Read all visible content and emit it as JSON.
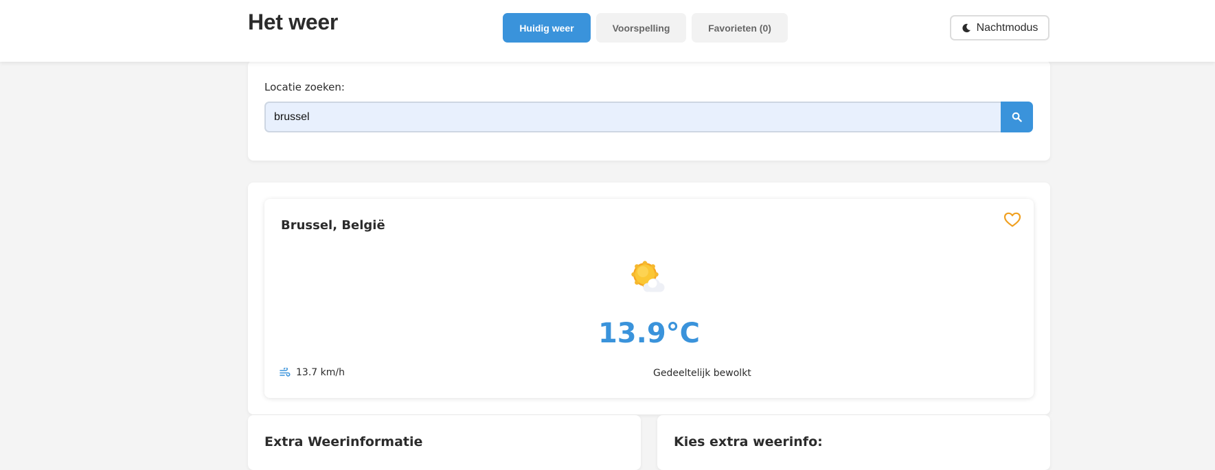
{
  "header": {
    "title": "Het weer",
    "tabs": [
      {
        "label": "Huidig weer",
        "active": true
      },
      {
        "label": "Voorspelling",
        "active": false
      },
      {
        "label": "Favorieten (0)",
        "active": false
      }
    ],
    "night_mode_label": "Nachtmodus",
    "night_mode_icon": "moon-icon"
  },
  "search": {
    "label": "Locatie zoeken:",
    "value": "brussel",
    "button_icon": "search-icon"
  },
  "weather": {
    "location": "Brussel, België",
    "favorite_icon": "heart-outline-icon",
    "condition_icon": "sun-behind-cloud-icon",
    "temperature": "13.9°C",
    "wind_icon": "wind-icon",
    "wind": "13.7 km/h",
    "condition": "Gedeeltelijk bewolkt"
  },
  "panels": {
    "extra_title": "Extra Weerinformatie",
    "choose_title": "Kies extra weerinfo:"
  },
  "colors": {
    "accent": "#3a93db",
    "favorite": "#f0a020",
    "background": "#f4f4f4"
  }
}
